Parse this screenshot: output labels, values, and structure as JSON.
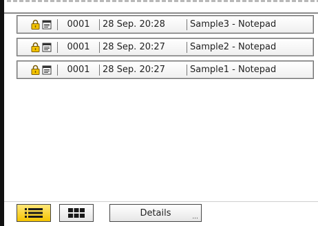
{
  "jobs": [
    {
      "number": "0001",
      "datetime": "28 Sep. 20:28",
      "name": "Sample3 - Notepad",
      "icons": [
        "lock-icon",
        "document-icon"
      ]
    },
    {
      "number": "0001",
      "datetime": "28 Sep. 20:27",
      "name": "Sample2 - Notepad",
      "icons": [
        "lock-icon",
        "document-icon"
      ]
    },
    {
      "number": "0001",
      "datetime": "28 Sep. 20:27",
      "name": "Sample1 - Notepad",
      "icons": [
        "lock-icon",
        "document-icon"
      ]
    }
  ],
  "toolbar": {
    "list_view_icon": "list-view-icon",
    "grid_view_icon": "thumbnail-view-icon",
    "details_label": "Details",
    "details_ellipsis": "..."
  },
  "colors": {
    "selected_button": "#f5c400",
    "lock_icon": "#d9a400",
    "row_border": "#6e6e6e"
  }
}
